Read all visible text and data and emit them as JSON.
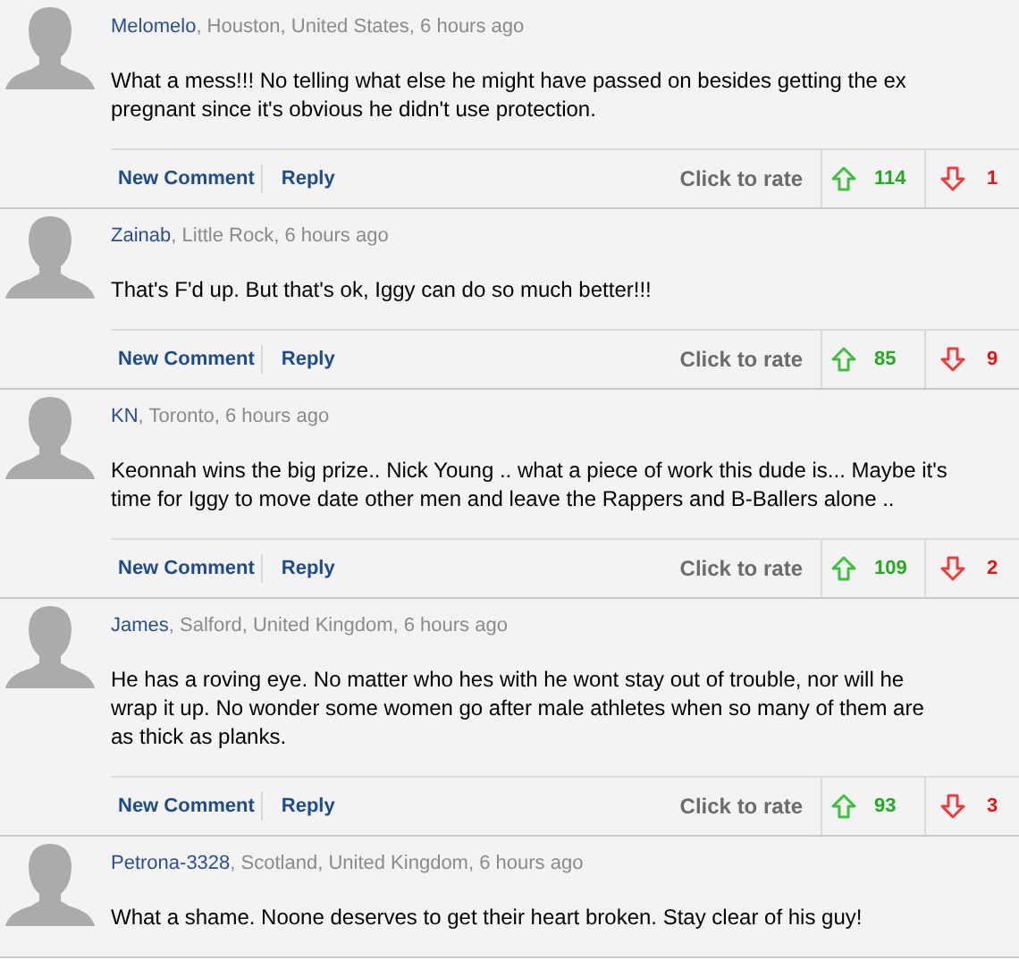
{
  "comments": [
    {
      "author": "Melomelo",
      "meta": ", Houston, United States, 6 hours ago",
      "body": "What a mess!!! No telling what else he might have passed on besides getting the ex pregnant since it's obvious he didn't use protection.",
      "actions": {
        "new_comment": "New Comment",
        "reply": "Reply",
        "rate_label": "Click to rate",
        "up": "114",
        "down": "1"
      }
    },
    {
      "author": "Zainab",
      "meta": ", Little Rock, 6 hours ago",
      "body": "That's F'd up. But that's ok, Iggy can do so much better!!!",
      "actions": {
        "new_comment": "New Comment",
        "reply": "Reply",
        "rate_label": "Click to rate",
        "up": "85",
        "down": "9"
      }
    },
    {
      "author": "KN",
      "meta": ", Toronto, 6 hours ago",
      "body": "Keonnah wins the big prize.. Nick Young .. what a piece of work this dude is... Maybe it's time for Iggy to move date other men and leave the Rappers and B-Ballers alone ..",
      "actions": {
        "new_comment": "New Comment",
        "reply": "Reply",
        "rate_label": "Click to rate",
        "up": "109",
        "down": "2"
      }
    },
    {
      "author": "James",
      "meta": ", Salford, United Kingdom, 6 hours ago",
      "body": "He has a roving eye. No matter who hes with he wont stay out of trouble, nor will he wrap it up. No wonder some women go after male athletes when so many of them are as thick as planks.",
      "actions": {
        "new_comment": "New Comment",
        "reply": "Reply",
        "rate_label": "Click to rate",
        "up": "93",
        "down": "3"
      }
    },
    {
      "author": "Petrona-3328",
      "meta": ", Scotland, United Kingdom, 6 hours ago",
      "body": "What a shame. Noone deserves to get their heart broken. Stay clear of his guy!"
    }
  ]
}
